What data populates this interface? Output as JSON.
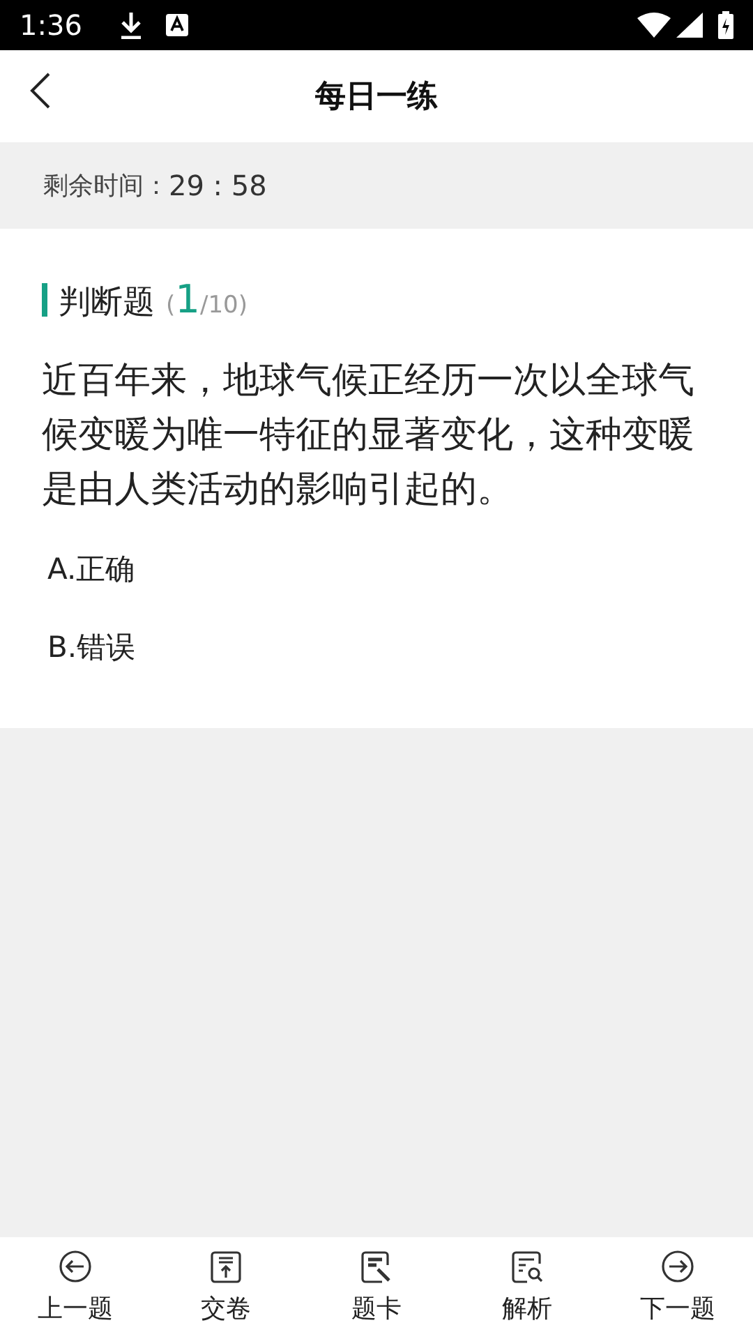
{
  "status_bar": {
    "time": "1:36"
  },
  "header": {
    "title": "每日一练"
  },
  "timer": {
    "label": "剩余时间：",
    "value": "29 : 58"
  },
  "question": {
    "type": "判断题",
    "open": "(",
    "index": "1",
    "total": "/10)",
    "text": "近百年来，地球气候正经历一次以全球气候变暖为唯一特征的显著变化，这种变暖是由人类活动的影响引起的。",
    "options": [
      {
        "label": "A.正确"
      },
      {
        "label": "B.错误"
      }
    ]
  },
  "bottom_nav": [
    {
      "label": "上一题"
    },
    {
      "label": "交卷"
    },
    {
      "label": "题卡"
    },
    {
      "label": "解析"
    },
    {
      "label": "下一题"
    }
  ]
}
